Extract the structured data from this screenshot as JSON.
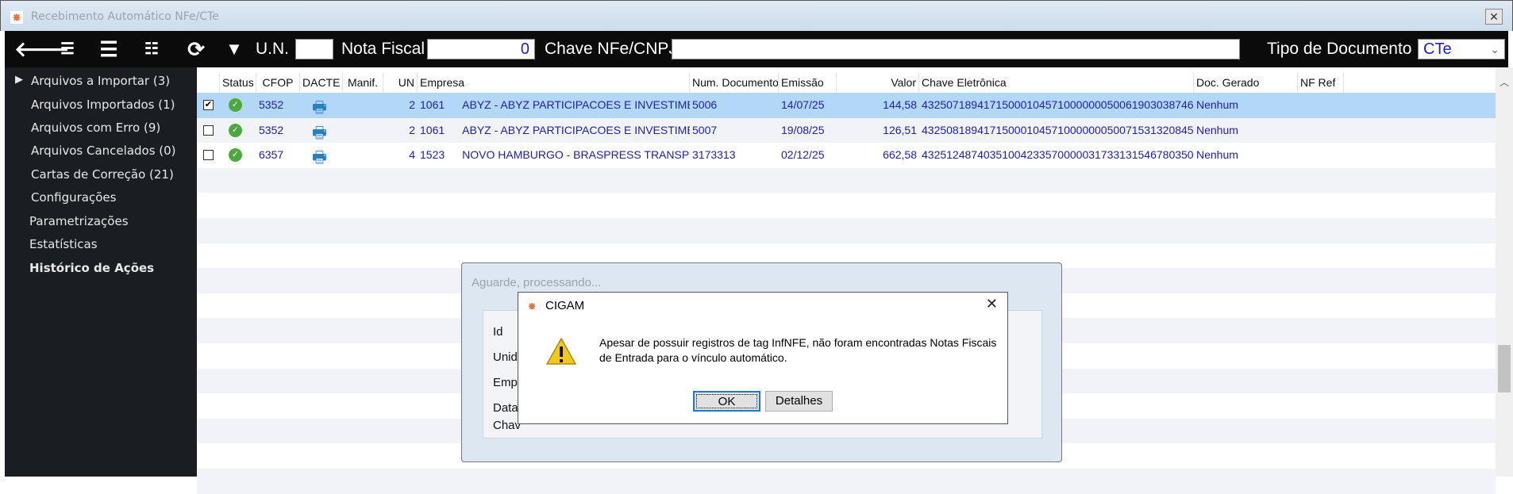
{
  "window": {
    "title": "Recebimento Automático NFe/CTe",
    "close": "✕",
    "logo": "⋇"
  },
  "toolbar": {
    "icons": [
      "back-arrow-icon",
      "check-list-icon",
      "list-icon",
      "toggle-check-list-icon",
      "refresh-icon",
      "filter-icon"
    ],
    "un_label": "U.N.",
    "un_value": "",
    "nota_label": "Nota Fiscal",
    "nota_value": "0",
    "chave_label": "Chave NFe/CNPJ",
    "chave_value": "",
    "tipo_label": "Tipo de Documento",
    "tipo_value": "CTe"
  },
  "sidebar": {
    "items": [
      {
        "label": "Arquivos a Importar (3)",
        "expanded_arrow": "▶"
      },
      {
        "label": "Arquivos Importados (1)"
      },
      {
        "label": "Arquivos com Erro (9)"
      },
      {
        "label": "Arquivos Cancelados (0)"
      },
      {
        "label": "Cartas de Correção (21)"
      },
      {
        "label": "Configurações"
      },
      {
        "label": "Parametrizações"
      },
      {
        "label": "Estatísticas"
      },
      {
        "label": "Histórico de Ações",
        "bold": true
      }
    ]
  },
  "table": {
    "columns": [
      "",
      "Status",
      "CFOP",
      "DACTE",
      "Manif.",
      "UN",
      "Empresa",
      "Num. Documento",
      "Emissão",
      "Valor",
      "Chave Eletrônica",
      "Doc. Gerado",
      "NF Ref"
    ],
    "rows": [
      {
        "checked": true,
        "status": "ok",
        "cfop": "5352",
        "manif": "",
        "un": "2",
        "emp_code": "1061",
        "empresa": "ABYZ - ABYZ PARTICIPACOES E INVESTIMENTOS",
        "num": "5006",
        "emissao": "14/07/25",
        "valor": "144,58",
        "chave": "43250718941715000104571000000050061903038746",
        "doc": "Nenhum",
        "nfref": ""
      },
      {
        "checked": false,
        "status": "ok",
        "cfop": "5352",
        "manif": "",
        "un": "2",
        "emp_code": "1061",
        "empresa": "ABYZ - ABYZ PARTICIPACOES E INVESTIMENTOS",
        "num": "5007",
        "emissao": "19/08/25",
        "valor": "126,51",
        "chave": "43250818941715000104571000000050071531320845",
        "doc": "Nenhum",
        "nfref": ""
      },
      {
        "checked": false,
        "status": "ok",
        "cfop": "6357",
        "manif": "",
        "un": "4",
        "emp_code": "1523",
        "empresa": "NOVO HAMBURGO - BRASPRESS TRANSPORTES",
        "num": "3173313",
        "emissao": "02/12/25",
        "valor": "662,58",
        "chave": "43251248740351004233570000031733131546780350",
        "doc": "Nenhum",
        "nfref": ""
      }
    ],
    "selected_color": "#b3d7f7"
  },
  "progress_dialog": {
    "title": "Aguarde, processando...",
    "labels": [
      "Id",
      "Unida",
      "Empr",
      "Data",
      "Chav"
    ]
  },
  "message_box": {
    "title": "CIGAM",
    "icon": "warning-icon",
    "message_line1": "Apesar de possuir registros de tag InfNFE, não foram encontradas Notas Fiscais",
    "message_line2": "de Entrada para o vínculo automático.",
    "ok_label": "OK",
    "details_label": "Detalhes"
  }
}
